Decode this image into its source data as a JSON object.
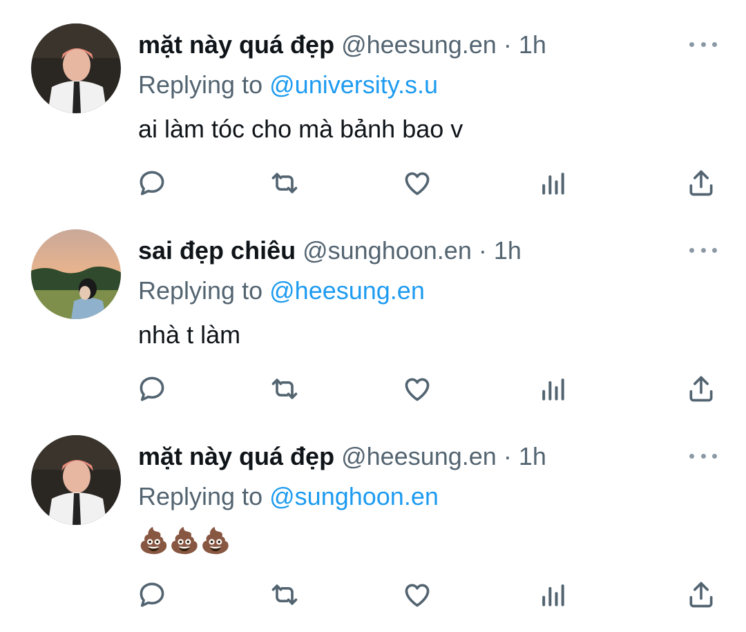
{
  "tweets": [
    {
      "name": "mặt này quá đẹp",
      "handle": "@heesung.en",
      "dot": "·",
      "time": "1h",
      "replying_prefix": "Replying to",
      "replying_to": "@university.s.u",
      "text": "ai làm tóc cho mà bảnh bao v"
    },
    {
      "name": "sai đẹp chiêu",
      "handle": "@sunghoon.en",
      "dot": "·",
      "time": "1h",
      "replying_prefix": "Replying to",
      "replying_to": "@heesung.en",
      "text": "nhà t làm"
    },
    {
      "name": "mặt này quá đẹp",
      "handle": "@heesung.en",
      "dot": "·",
      "time": "1h",
      "replying_prefix": "Replying to",
      "replying_to": "@sunghoon.en",
      "text": "💩💩💩"
    }
  ],
  "icons": {
    "actions": [
      "reply-icon",
      "retweet-icon",
      "like-icon",
      "views-icon",
      "share-icon"
    ],
    "more": "more-icon"
  },
  "colors": {
    "text": "#0f1419",
    "secondary": "#536471",
    "link": "#1d9bf0",
    "icon": "#536471"
  }
}
